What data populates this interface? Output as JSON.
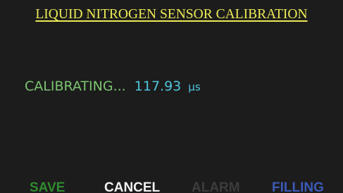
{
  "screen": {
    "title": "LIQUID NITROGEN SENSOR CALIBRATION",
    "status_label": "CALIBRATING...",
    "status_value": "117.93",
    "status_unit": "μs"
  },
  "softkeys": {
    "save": "SAVE",
    "cancel": "CANCEL",
    "alarm": "ALARM",
    "filling": "FILLING"
  },
  "colors": {
    "background": "#1c1c1c",
    "title": "#ecea55",
    "status_label": "#7cc470",
    "status_value": "#4fc4dd",
    "save": "#2f8a2f",
    "cancel": "#f2f2f2",
    "alarm_disabled": "#3c3c3c",
    "filling": "#3c5ab8"
  }
}
